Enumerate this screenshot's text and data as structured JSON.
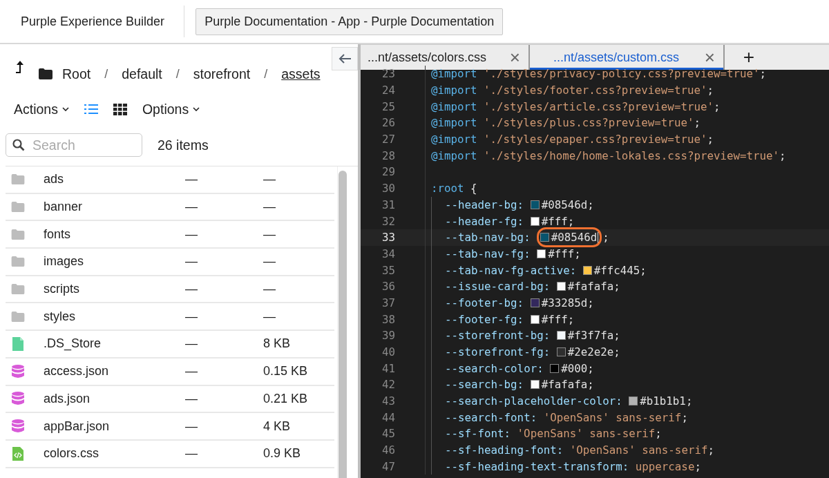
{
  "header": {
    "app_title": "Purple Experience Builder",
    "open_app": "Purple Documentation - App - Purple Documentation"
  },
  "breadcrumb": [
    {
      "label": "Root",
      "current": false
    },
    {
      "label": "default",
      "current": false
    },
    {
      "label": "storefront",
      "current": false
    },
    {
      "label": "assets",
      "current": true
    }
  ],
  "breadcrumb_separator": "/",
  "toolbar": {
    "actions": "Actions",
    "options": "Options",
    "views": [
      {
        "kind": "list",
        "selected": true
      },
      {
        "kind": "grid",
        "selected": false
      }
    ]
  },
  "search": {
    "placeholder": "Search"
  },
  "item_count": "26 items",
  "files": [
    {
      "kind": "folder",
      "name": "ads",
      "column_2": "—",
      "size": "—"
    },
    {
      "kind": "folder",
      "name": "banner",
      "column_2": "—",
      "size": "—"
    },
    {
      "kind": "folder",
      "name": "fonts",
      "column_2": "—",
      "size": "—"
    },
    {
      "kind": "folder",
      "name": "images",
      "column_2": "—",
      "size": "—"
    },
    {
      "kind": "folder",
      "name": "scripts",
      "column_2": "—",
      "size": "—"
    },
    {
      "kind": "folder",
      "name": "styles",
      "column_2": "—",
      "size": "—"
    },
    {
      "kind": "file",
      "name": ".DS_Store",
      "column_2": "—",
      "size": "8 KB"
    },
    {
      "kind": "data",
      "name": "access.json",
      "column_2": "—",
      "size": "0.15 KB"
    },
    {
      "kind": "data",
      "name": "ads.json",
      "column_2": "—",
      "size": "0.21 KB"
    },
    {
      "kind": "data",
      "name": "appBar.json",
      "column_2": "—",
      "size": "4 KB"
    },
    {
      "kind": "code",
      "name": "colors.css",
      "column_2": "—",
      "size": "0.9 KB"
    }
  ],
  "editor_tabs": [
    {
      "label": "...nt/assets/colors.css",
      "close": "×",
      "selected": false
    },
    {
      "label": "...nt/assets/custom.css",
      "close": "×",
      "selected": true
    }
  ],
  "new_tab": "+",
  "code": [
    {
      "number": "23",
      "current": false,
      "tokens": [
        {
          "kind": "keyword",
          "text": "@import"
        },
        {
          "kind": "string",
          "text": "'./styles/privacy-policy.css?preview=true'"
        },
        {
          "kind": "punct",
          "text": ";"
        }
      ]
    },
    {
      "number": "24",
      "current": false,
      "tokens": [
        {
          "kind": "keyword",
          "text": "@import"
        },
        {
          "kind": "string",
          "text": "'./styles/footer.css?preview=true'"
        },
        {
          "kind": "punct",
          "text": ";"
        }
      ]
    },
    {
      "number": "25",
      "current": false,
      "tokens": [
        {
          "kind": "keyword",
          "text": "@import"
        },
        {
          "kind": "string",
          "text": "'./styles/article.css?preview=true'"
        },
        {
          "kind": "punct",
          "text": ";"
        }
      ]
    },
    {
      "number": "26",
      "current": false,
      "tokens": [
        {
          "kind": "keyword",
          "text": "@import"
        },
        {
          "kind": "string",
          "text": "'./styles/plus.css?preview=true'"
        },
        {
          "kind": "punct",
          "text": ";"
        }
      ]
    },
    {
      "number": "27",
      "current": false,
      "tokens": [
        {
          "kind": "keyword",
          "text": "@import"
        },
        {
          "kind": "string",
          "text": "'./styles/epaper.css?preview=true'"
        },
        {
          "kind": "punct",
          "text": ";"
        }
      ]
    },
    {
      "number": "28",
      "current": false,
      "tokens": [
        {
          "kind": "keyword",
          "text": "@import"
        },
        {
          "kind": "string",
          "text": "'./styles/home/home-lokales.css?preview=true'"
        },
        {
          "kind": "punct",
          "text": ";"
        }
      ]
    },
    {
      "number": "29",
      "current": false
    },
    {
      "number": "30",
      "current": false,
      "tokens": [
        {
          "kind": "keyword",
          "text": ":root"
        },
        {
          "kind": "brace",
          "text": "{"
        }
      ],
      "children": [
        {
          "number": "31",
          "current": false,
          "tokens": [
            {
              "kind": "property",
              "text": "--header-bg:"
            },
            {
              "kind": "color",
              "color": "#08546d",
              "text": "#08546d"
            },
            {
              "kind": "punct",
              "text": ";"
            }
          ]
        },
        {
          "number": "32",
          "current": false,
          "tokens": [
            {
              "kind": "property",
              "text": "--header-fg:"
            },
            {
              "kind": "color",
              "color": "#ffffff",
              "text": "#fff"
            },
            {
              "kind": "punct",
              "text": ";"
            }
          ]
        },
        {
          "number": "33",
          "current": true,
          "tokens": [
            {
              "kind": "property",
              "text": "--tab-nav-bg:"
            },
            {
              "kind": "color",
              "color": "#08546d",
              "text": "#08546d"
            },
            {
              "kind": "punct",
              "text": ";"
            }
          ]
        },
        {
          "number": "34",
          "current": false,
          "tokens": [
            {
              "kind": "property",
              "text": "--tab-nav-fg:"
            },
            {
              "kind": "color",
              "color": "#ffffff",
              "text": "#fff"
            },
            {
              "kind": "punct",
              "text": ";"
            }
          ]
        },
        {
          "number": "35",
          "current": false,
          "tokens": [
            {
              "kind": "property",
              "text": "--tab-nav-fg-active:"
            },
            {
              "kind": "color",
              "color": "#ffc445",
              "text": "#ffc445"
            },
            {
              "kind": "punct",
              "text": ";"
            }
          ]
        },
        {
          "number": "36",
          "current": false,
          "tokens": [
            {
              "kind": "property",
              "text": "--issue-card-bg:"
            },
            {
              "kind": "color",
              "color": "#fafafa",
              "text": "#fafafa"
            },
            {
              "kind": "punct",
              "text": ";"
            }
          ]
        },
        {
          "number": "37",
          "current": false,
          "tokens": [
            {
              "kind": "property",
              "text": "--footer-bg:"
            },
            {
              "kind": "color",
              "color": "#33285d",
              "text": "#33285d"
            },
            {
              "kind": "punct",
              "text": ";"
            }
          ]
        },
        {
          "number": "38",
          "current": false,
          "tokens": [
            {
              "kind": "property",
              "text": "--footer-fg:"
            },
            {
              "kind": "color",
              "color": "#ffffff",
              "text": "#fff"
            },
            {
              "kind": "punct",
              "text": ";"
            }
          ]
        },
        {
          "number": "39",
          "current": false,
          "tokens": [
            {
              "kind": "property",
              "text": "--storefront-bg:"
            },
            {
              "kind": "color",
              "color": "#f3f7fa",
              "text": "#f3f7fa"
            },
            {
              "kind": "punct",
              "text": ";"
            }
          ]
        },
        {
          "number": "40",
          "current": false,
          "tokens": [
            {
              "kind": "property",
              "text": "--storefront-fg:"
            },
            {
              "kind": "color",
              "color": "#2e2e2e",
              "text": "#2e2e2e"
            },
            {
              "kind": "punct",
              "text": ";"
            }
          ]
        },
        {
          "number": "41",
          "current": false,
          "tokens": [
            {
              "kind": "property",
              "text": "--search-color:"
            },
            {
              "kind": "color",
              "color": "#000000",
              "text": "#000"
            },
            {
              "kind": "punct",
              "text": ";"
            }
          ]
        },
        {
          "number": "42",
          "current": false,
          "tokens": [
            {
              "kind": "property",
              "text": "--search-bg:"
            },
            {
              "kind": "color",
              "color": "#fafafa",
              "text": "#fafafa"
            },
            {
              "kind": "punct",
              "text": ";"
            }
          ]
        },
        {
          "number": "43",
          "current": false,
          "tokens": [
            {
              "kind": "property",
              "text": "--search-placeholder-color:"
            },
            {
              "kind": "color",
              "color": "#b1b1b1",
              "text": "#b1b1b1"
            },
            {
              "kind": "punct",
              "text": ";"
            }
          ]
        },
        {
          "number": "44",
          "current": false,
          "tokens": [
            {
              "kind": "property",
              "text": "--search-font:"
            },
            {
              "kind": "string",
              "text": "'OpenSans' sans-serif"
            },
            {
              "kind": "punct",
              "text": ";"
            }
          ]
        },
        {
          "number": "45",
          "current": false,
          "tokens": [
            {
              "kind": "property",
              "text": "--sf-font:"
            },
            {
              "kind": "string",
              "text": "'OpenSans' sans-serif"
            },
            {
              "kind": "punct",
              "text": ";"
            }
          ]
        },
        {
          "number": "46",
          "current": false,
          "tokens": [
            {
              "kind": "property",
              "text": "--sf-heading-font:"
            },
            {
              "kind": "string",
              "text": "'OpenSans' sans-serif"
            },
            {
              "kind": "punct",
              "text": ";"
            }
          ]
        },
        {
          "number": "47",
          "current": false,
          "tokens": [
            {
              "kind": "property",
              "text": "--sf-heading-text-transform:"
            },
            {
              "kind": "string",
              "text": "uppercase"
            },
            {
              "kind": "punct",
              "text": ";"
            }
          ]
        }
      ]
    }
  ]
}
